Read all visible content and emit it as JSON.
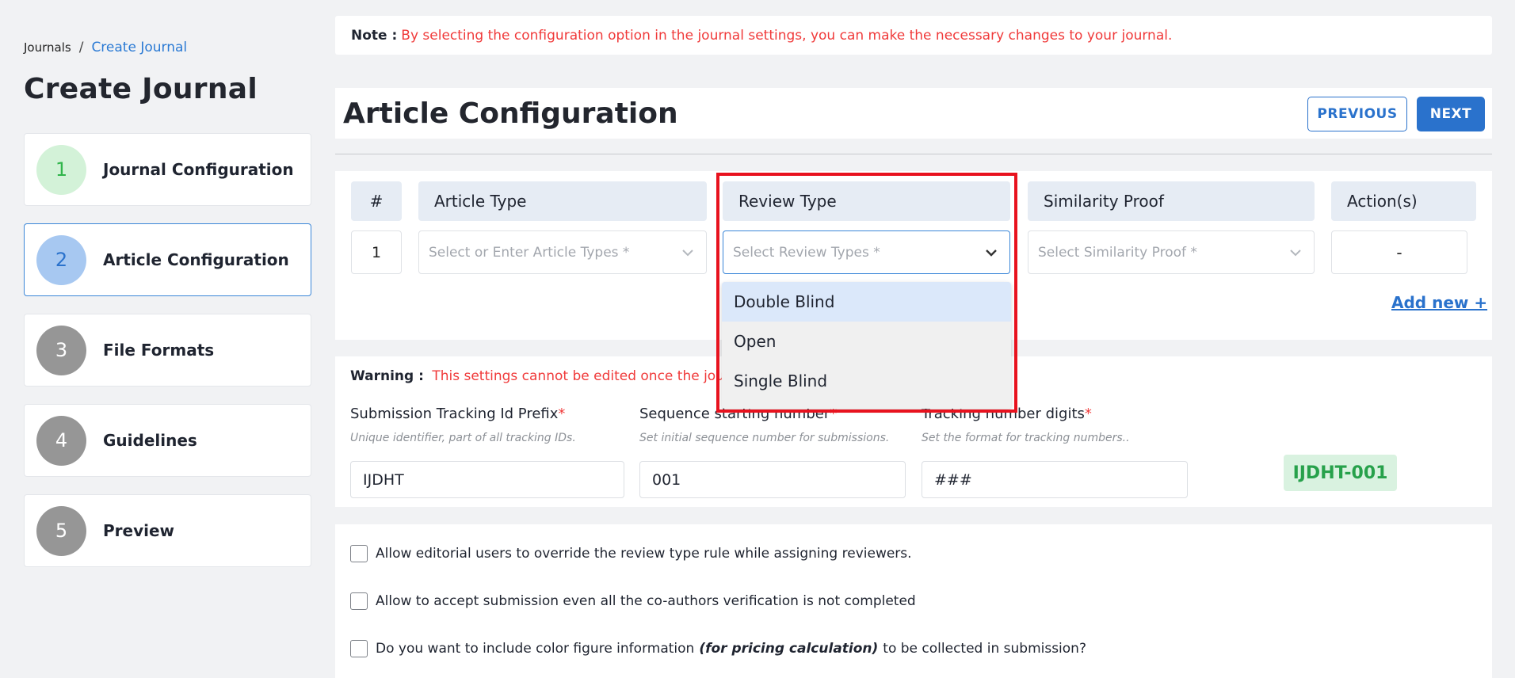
{
  "breadcrumb": {
    "root": "Journals",
    "separator": "/",
    "current": "Create Journal"
  },
  "page_title": "Create Journal",
  "steps": [
    {
      "num": "1",
      "label": "Journal Configuration",
      "state": "done"
    },
    {
      "num": "2",
      "label": "Article Configuration",
      "state": "current"
    },
    {
      "num": "3",
      "label": "File Formats",
      "state": "pending"
    },
    {
      "num": "4",
      "label": "Guidelines",
      "state": "pending"
    },
    {
      "num": "5",
      "label": "Preview",
      "state": "pending"
    }
  ],
  "note": {
    "key": "Note :",
    "text": "By selecting the configuration option in the journal settings, you can make the necessary changes to your journal."
  },
  "header": {
    "title": "Article Configuration",
    "previous_label": "PREVIOUS",
    "next_label": "NEXT"
  },
  "table": {
    "headers": {
      "hash": "#",
      "article_type": "Article Type",
      "review_type": "Review Type",
      "similarity_proof": "Similarity Proof",
      "actions": "Action(s)"
    },
    "row": {
      "num": "1",
      "article_type_placeholder": "Select or Enter Article Types *",
      "review_type_placeholder": "Select Review Types *",
      "similarity_proof_placeholder": "Select Similarity Proof *",
      "action": "-"
    },
    "add_new": "Add new +"
  },
  "review_dropdown": {
    "options": [
      "Double Blind",
      "Open",
      "Single Blind"
    ],
    "highlighted": "Double Blind"
  },
  "warning": {
    "key": "Warning :",
    "text": "This settings cannot be edited once the journ"
  },
  "fields": {
    "prefix": {
      "label": "Submission Tracking Id Prefix",
      "required": "*",
      "hint": "Unique identifier, part of all tracking IDs.",
      "value": "IJDHT"
    },
    "sequence": {
      "label": "Sequence starting number",
      "required": "*",
      "hint": "Set initial sequence number for submissions.",
      "value": "001"
    },
    "digits": {
      "label": "Tracking number digits",
      "required": "*",
      "hint": "Set the format for tracking numbers..",
      "value": "###"
    }
  },
  "tracking_preview": "IJDHT-001",
  "checkboxes": [
    {
      "text": "Allow editorial users to override the review type rule while assigning reviewers."
    },
    {
      "text": "Allow to accept submission even all the co-authors verification is not completed"
    },
    {
      "pre": "Do you want to include color figure information",
      "em": "(for pricing calculation)",
      "post": "to be collected in submission?"
    }
  ],
  "colors": {
    "accent": "#2a72cc",
    "danger": "#f03a3a",
    "success": "#27a14b",
    "highlight_frame": "#e8121e"
  },
  "icons": {
    "select_chevron": "chevron-down-icon"
  }
}
